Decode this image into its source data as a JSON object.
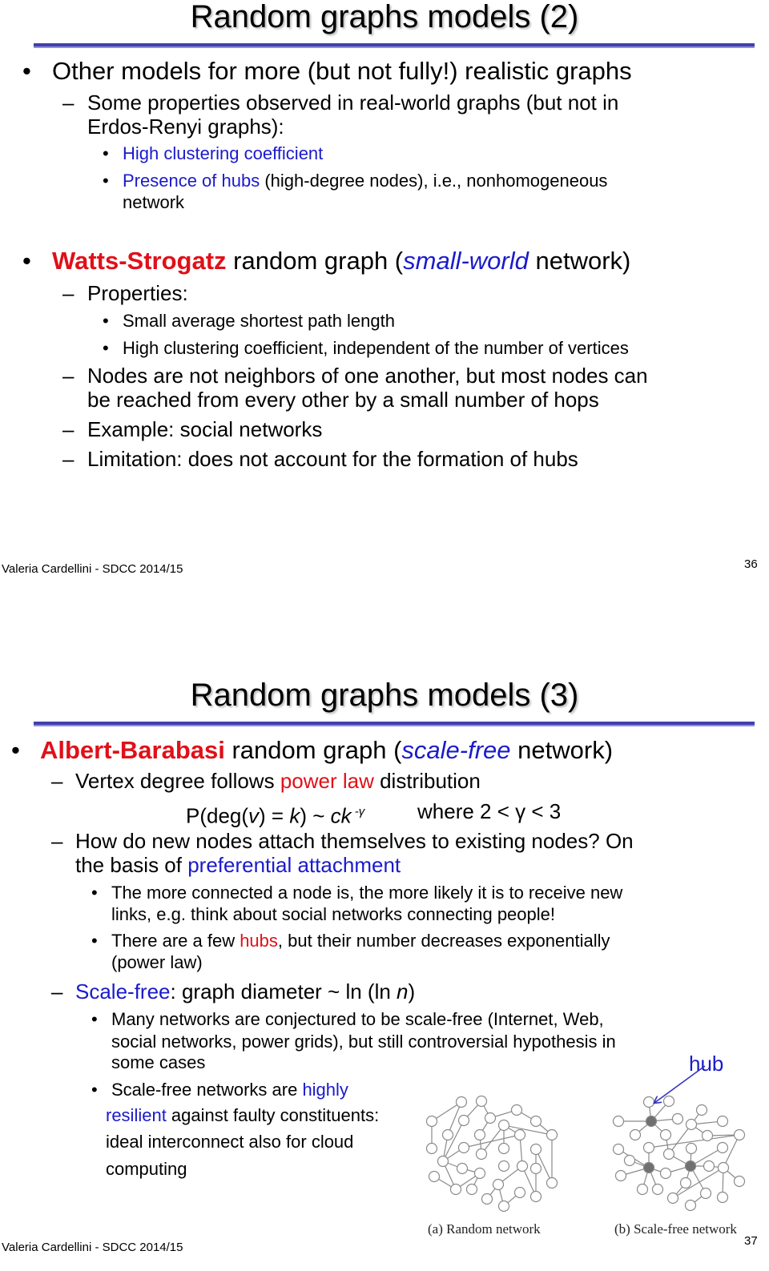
{
  "slides": [
    {
      "title": "Random graphs models (2)",
      "footer": "Valeria Cardellini - SDCC 2014/15",
      "page_number": "36",
      "bullets": {
        "b1": "Other models for more (but not fully!) realistic graphs",
        "b1_sub1_line1": "Some properties observed in real-world graphs (but not in",
        "b1_sub1_line2": "Erdos-Renyi graphs):",
        "b1_sub1_item1": "High clustering coefficient",
        "b1_sub1_item2_hl": "Presence of hubs",
        "b1_sub1_item2_rest": " (high-degree nodes), i.e., nonhomogeneous",
        "b1_sub1_item2_line2": "network",
        "b2_hl": "Watts-Strogatz",
        "b2_mid": " random graph (",
        "b2_em": "small-world",
        "b2_end": " network)",
        "b2_sub1": "Properties:",
        "b2_sub1_item1": "Small average shortest path length",
        "b2_sub1_item2": "High clustering coefficient, independent of the number of vertices",
        "b2_sub2_line1": "Nodes are not neighbors of one another, but most nodes can",
        "b2_sub2_line2": "be reached from every other by a small number of hops",
        "b2_sub3": "Example: social networks",
        "b2_sub4": "Limitation: does not account for the formation of hubs"
      }
    },
    {
      "title": "Random graphs models (3)",
      "footer": "Valeria Cardellini - SDCC 2014/15",
      "page_number": "37",
      "bullets": {
        "b1_hl": "Albert-Barabasi",
        "b1_mid": " random graph (",
        "b1_em": "scale-free",
        "b1_end": " network)",
        "s1_pre": "Vertex degree follows ",
        "s1_hl": "power law",
        "s1_post": " distribution",
        "formula_p": "P(deg(",
        "formula_v": "v",
        "formula_eq": ") = ",
        "formula_k": "k",
        "formula_tilde": ") ~ ",
        "formula_ck": "ck",
        "formula_exp": " -γ",
        "formula_where": "where 2 < γ < 3",
        "s2_line1": "How do new nodes attach themselves to existing nodes? On",
        "s2_line2_pre": "the basis of ",
        "s2_line2_hl": "preferential attachment",
        "s2_item1_line1": "The more connected a node is, the more likely it is to receive new",
        "s2_item1_line2": "links, e.g. think about social networks connecting people!",
        "s2_item2_pre": "There are a few ",
        "s2_item2_hl": "hubs",
        "s2_item2_post": ", but their number decreases exponentially",
        "s2_item2_line2": "(power law)",
        "s3_hl": "Scale-free",
        "s3_mid": ": graph diameter ~ ln (ln ",
        "s3_n": "n",
        "s3_end": ")",
        "s3_item1_line1": "Many networks are conjectured to be scale-free (Internet, Web,",
        "s3_item1_line2": "social networks, power grids), but still controversial hypothesis in",
        "s3_item1_line3": "some cases",
        "s3_item2_pre": "Scale-free networks are ",
        "s3_item2_hl1": "highly",
        "s3_item2_hl2": "resilient",
        "s3_item2_line2_post": " against faulty constituents:",
        "s3_item2_line3": "ideal interconnect also for cloud",
        "s3_item2_line4": "computing"
      },
      "figure": {
        "hub_label": "hub",
        "caption_a": "(a) Random network",
        "caption_b": "(b) Scale-free network",
        "random_network": {
          "node_count": 32,
          "edges": [
            [
              2,
              0
            ],
            [
              2,
              12
            ],
            [
              0,
              7
            ],
            [
              7,
              17
            ],
            [
              1,
              4
            ],
            [
              1,
              3
            ],
            [
              3,
              17
            ],
            [
              4,
              5
            ],
            [
              5,
              6
            ],
            [
              6,
              11
            ],
            [
              4,
              8
            ],
            [
              8,
              14
            ],
            [
              9,
              10
            ],
            [
              9,
              11
            ],
            [
              9,
              15
            ],
            [
              10,
              21
            ],
            [
              10,
              13
            ],
            [
              13,
              17
            ],
            [
              11,
              27
            ],
            [
              16,
              22
            ],
            [
              16,
              27
            ],
            [
              17,
              18
            ],
            [
              17,
              24
            ],
            [
              18,
              19
            ],
            [
              19,
              24
            ],
            [
              19,
              25
            ],
            [
              21,
              26
            ],
            [
              21,
              30
            ],
            [
              22,
              30
            ],
            [
              23,
              24
            ],
            [
              26,
              28
            ],
            [
              26,
              31
            ],
            [
              31,
              29
            ],
            [
              14,
              9
            ]
          ]
        },
        "scale_free_network": {
          "node_count": 32,
          "hubs": [
            0,
            18,
            20
          ],
          "edges": [
            [
              0,
              1
            ],
            [
              0,
              2
            ],
            [
              0,
              3
            ],
            [
              0,
              4
            ],
            [
              0,
              5
            ],
            [
              0,
              6
            ],
            [
              6,
              14
            ],
            [
              7,
              8
            ],
            [
              8,
              9
            ],
            [
              8,
              10
            ],
            [
              8,
              14
            ],
            [
              10,
              11
            ],
            [
              11,
              13
            ],
            [
              12,
              18
            ],
            [
              13,
              18
            ],
            [
              17,
              18
            ],
            [
              18,
              23
            ],
            [
              18,
              25
            ],
            [
              18,
              26
            ],
            [
              18,
              19
            ],
            [
              19,
              20
            ],
            [
              14,
              20
            ],
            [
              15,
              20
            ],
            [
              20,
              21
            ],
            [
              20,
              27
            ],
            [
              20,
              28
            ],
            [
              21,
              22
            ],
            [
              16,
              20
            ],
            [
              22,
              24
            ],
            [
              22,
              29
            ],
            [
              22,
              30
            ],
            [
              22,
              11
            ],
            [
              27,
              29
            ],
            [
              28,
              31
            ]
          ]
        }
      }
    }
  ]
}
